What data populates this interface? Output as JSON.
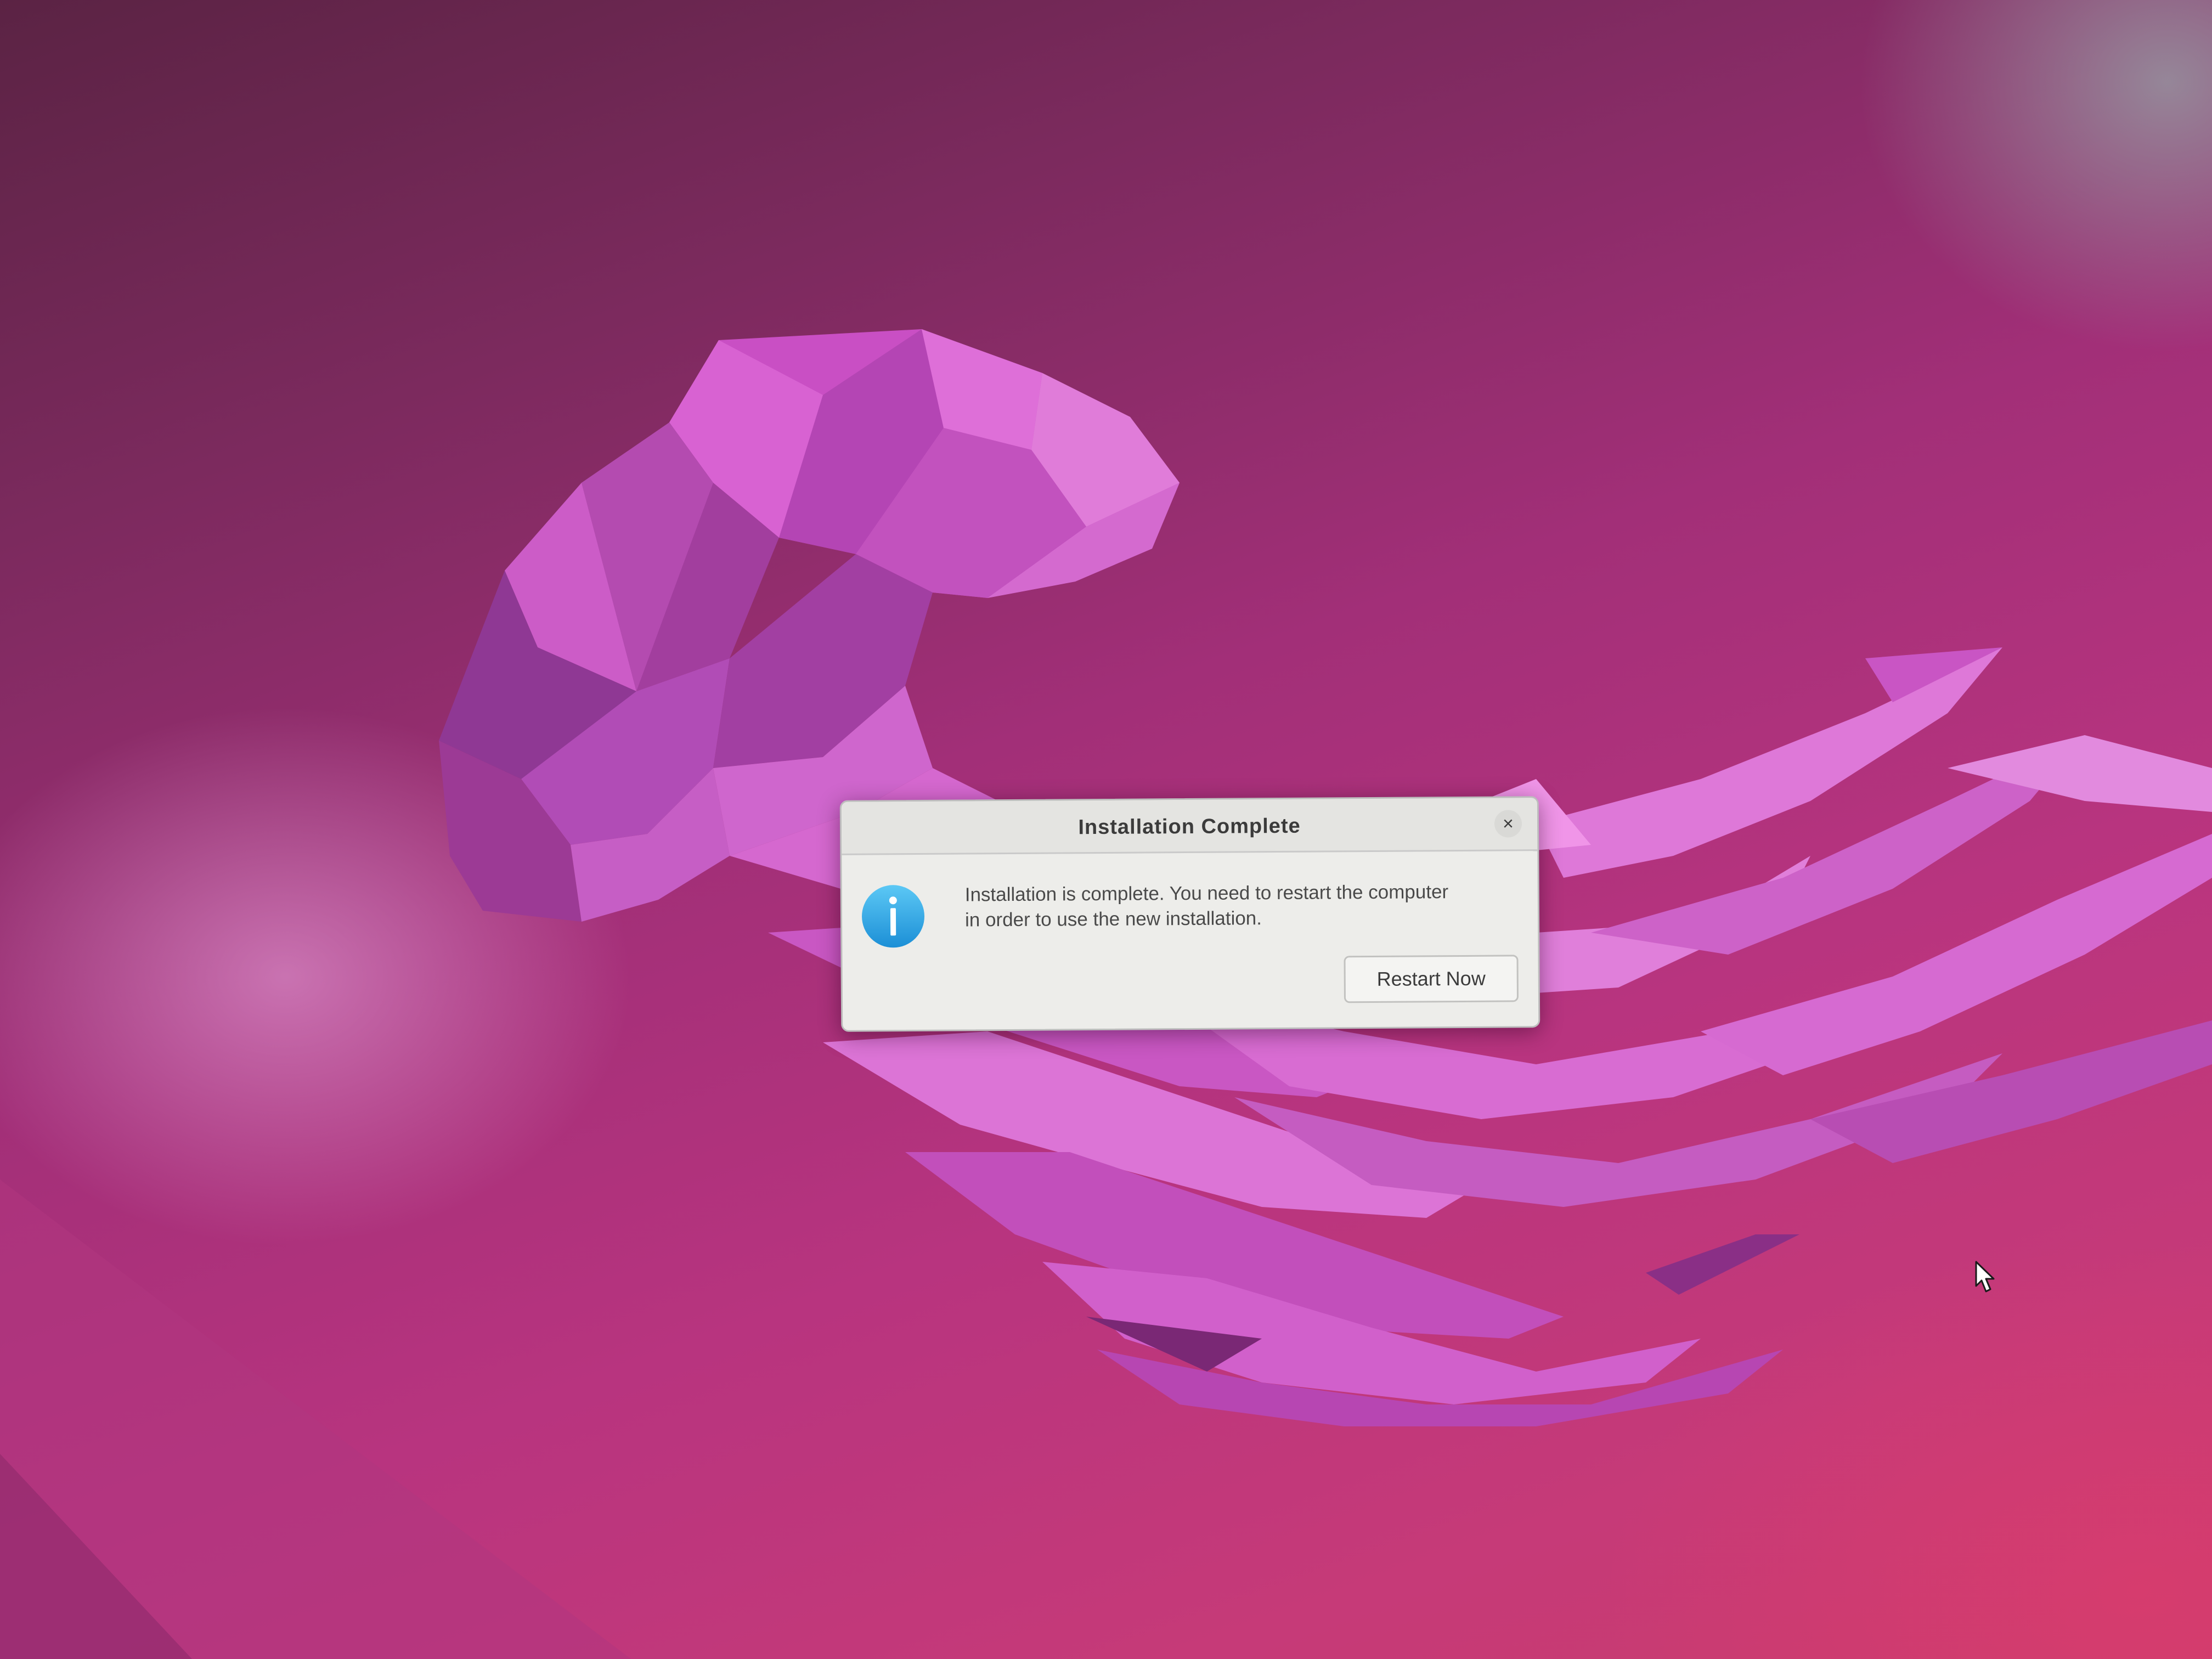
{
  "desktop": {
    "wallpaper": "ubuntu-jellyfish-wallpaper",
    "accent_colors": [
      "#7c2a5e",
      "#b8347f",
      "#d55fd0",
      "#c93c6c"
    ]
  },
  "dialog": {
    "title": "Installation Complete",
    "close_icon": "close-icon",
    "info_icon": "info-icon",
    "message_line1": "Installation is complete. You need to restart the computer",
    "message_line2": "in order to use the new installation.",
    "restart_label": "Restart Now"
  },
  "pointer": {
    "icon": "mouse-cursor-icon"
  }
}
